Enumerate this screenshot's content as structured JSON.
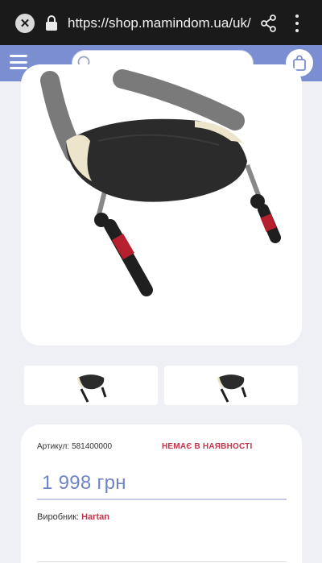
{
  "browser": {
    "url": "https://shop.mamindom.ua/uk/k",
    "close_glyph": "✕"
  },
  "header": {
    "search_placeholder": "",
    "icons": [
      "menu-icon",
      "search-icon",
      "cart-icon"
    ],
    "colors": {
      "header_bg": "#7b8ed1"
    }
  },
  "product": {
    "image_icon": "product-image-stroller-muff",
    "thumbnails": [
      "thumbnail-1",
      "thumbnail-2"
    ],
    "sku_label": "Артикул:",
    "sku_value": "581400000",
    "stock_status": "НЕМАЄ В НАЯВНОСТІ",
    "price": "1 998 грн",
    "maker_label": "Виробник:",
    "maker_value": "Hartan",
    "colors": {
      "price": "#6f83c7",
      "status": "#c4344d",
      "link": "#c4344d"
    }
  }
}
